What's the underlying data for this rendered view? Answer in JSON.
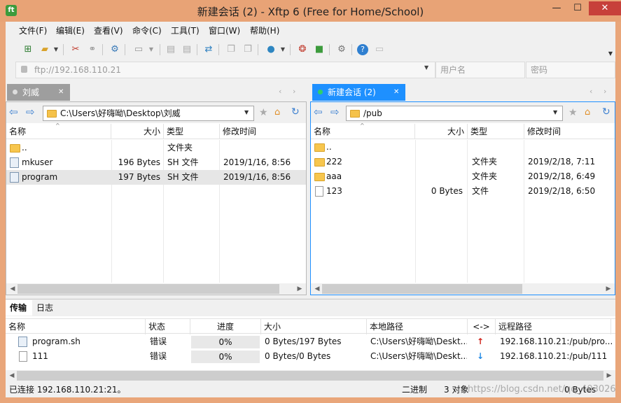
{
  "window": {
    "title": "新建会话 (2)    - Xftp 6 (Free for Home/School)",
    "app_icon_label": "ft",
    "minimize": "—",
    "maximize": "☐",
    "close": "✕"
  },
  "menu": [
    "文件(F)",
    "编辑(E)",
    "查看(V)",
    "命令(C)",
    "工具(T)",
    "窗口(W)",
    "帮助(H)"
  ],
  "address": {
    "host_placeholder": "ftp://192.168.110.21",
    "username_placeholder": "用户名",
    "password_placeholder": "密码"
  },
  "left": {
    "tab_label": "刘威",
    "path": "C:\\Users\\好嗨呦\\Desktop\\刘威",
    "columns": [
      "名称",
      "大小",
      "类型",
      "修改时间"
    ],
    "rows": [
      {
        "name": "..",
        "size": "",
        "type": "文件夹",
        "modified": "",
        "icon": "folder"
      },
      {
        "name": "mkuser",
        "size": "196 Bytes",
        "type": "SH 文件",
        "modified": "2019/1/16, 8:56",
        "icon": "script"
      },
      {
        "name": "program",
        "size": "197 Bytes",
        "type": "SH 文件",
        "modified": "2019/1/16, 8:56",
        "icon": "script"
      }
    ]
  },
  "right": {
    "tab_label": "新建会话 (2)",
    "path": "/pub",
    "columns": [
      "名称",
      "大小",
      "类型",
      "修改时间"
    ],
    "rows": [
      {
        "name": "..",
        "size": "",
        "type": "",
        "modified": "",
        "icon": "folder"
      },
      {
        "name": "222",
        "size": "",
        "type": "文件夹",
        "modified": "2019/2/18, 7:11",
        "icon": "folder"
      },
      {
        "name": "aaa",
        "size": "",
        "type": "文件夹",
        "modified": "2019/2/18, 6:49",
        "icon": "folder"
      },
      {
        "name": "123",
        "size": "0 Bytes",
        "type": "文件",
        "modified": "2019/2/18, 6:50",
        "icon": "file"
      }
    ]
  },
  "transfer": {
    "tabs": [
      "传输",
      "日志"
    ],
    "columns": [
      "名称",
      "状态",
      "进度",
      "大小",
      "本地路径",
      "<->",
      "远程路径"
    ],
    "rows": [
      {
        "name": "program.sh",
        "status": "错误",
        "progress": "0%",
        "size": "0 Bytes/197 Bytes",
        "local": "C:\\Users\\好嗨呦\\Deskt...",
        "direction": "up",
        "remote": "192.168.110.21:/pub/pro...",
        "icon": "script"
      },
      {
        "name": "111",
        "status": "错误",
        "progress": "0%",
        "size": "0 Bytes/0 Bytes",
        "local": "C:\\Users\\好嗨呦\\Deskt...",
        "direction": "down",
        "remote": "192.168.110.21:/pub/111",
        "icon": "file"
      }
    ]
  },
  "status": {
    "connected": "已连接 192.168.110.21:21。",
    "mode": "二进制",
    "objects": "3 对象",
    "bytes": "0 Bytes",
    "watermark": "https://blog.csdn.net/qq_40302647"
  },
  "colors": {
    "titlebar": "#e8a376",
    "accent_tab": "#1e90ff",
    "close": "#c7403a"
  }
}
